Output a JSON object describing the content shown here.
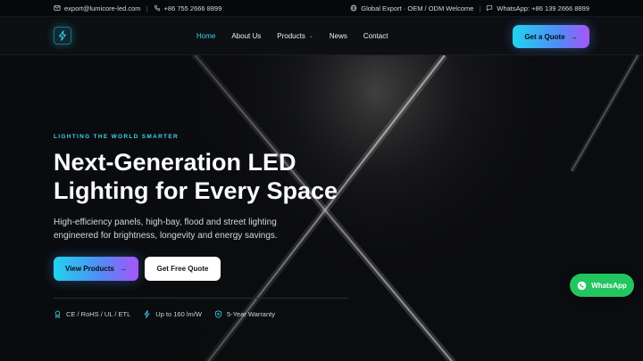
{
  "topbar": {
    "email": "export@lumicore-led.com",
    "phone": "+86 755 2666 8899",
    "export_note": "Global Export · OEM / ODM Welcome",
    "whatsapp": "WhatsApp: +86 139 2666 8899"
  },
  "nav": {
    "items": [
      {
        "label": "Home",
        "active": true
      },
      {
        "label": "About Us"
      },
      {
        "label": "Products",
        "dropdown": true
      },
      {
        "label": "News"
      },
      {
        "label": "Contact"
      }
    ],
    "cta_label": "Get a Quote",
    "cta_arrow": "→"
  },
  "hero": {
    "eyebrow": "LIGHTING THE WORLD SMARTER",
    "title": "Next-Generation LED Lighting for Every Space",
    "subtitle": "High-efficiency panels, high-bay, flood and street lighting engineered for brightness, longevity and energy savings.",
    "primary_button": "View Products",
    "primary_arrow": "→",
    "secondary_button": "Get Free Quote",
    "features": [
      {
        "icon": "certificate-icon",
        "label": "CE / RoHS / UL / ETL"
      },
      {
        "icon": "lightning-icon",
        "label": "Up to 160 lm/W"
      },
      {
        "icon": "shield-icon",
        "label": "5-Year Warranty"
      }
    ]
  },
  "whatsapp_button": "WhatsApp",
  "colors": {
    "accent_cyan": "#22d3ee",
    "accent_purple": "#a855f7",
    "whatsapp_green": "#22c55e",
    "background": "#0a0b0e"
  }
}
